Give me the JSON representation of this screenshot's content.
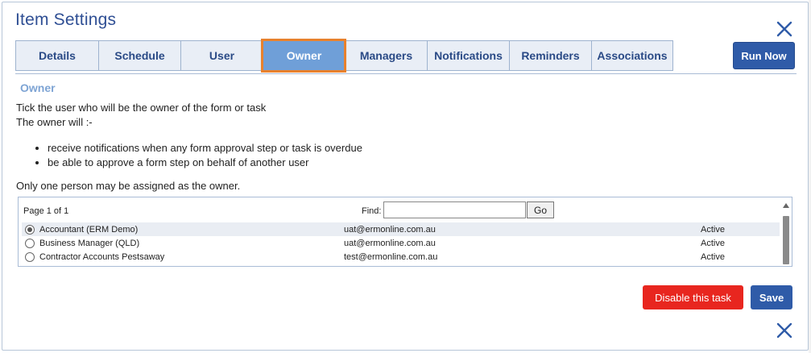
{
  "dialog": {
    "title": "Item Settings",
    "run_now_label": "Run Now"
  },
  "tabs": [
    {
      "label": "Details"
    },
    {
      "label": "Schedule"
    },
    {
      "label": "User"
    },
    {
      "label": "Owner",
      "active": true
    },
    {
      "label": "Managers"
    },
    {
      "label": "Notifications"
    },
    {
      "label": "Reminders"
    },
    {
      "label": "Associations"
    }
  ],
  "owner": {
    "heading": "Owner",
    "intro_line1": "Tick the user who will be the owner of the form or task",
    "intro_line2": "The owner will :-",
    "bullets": [
      "receive notifications when any form approval step or task is overdue",
      "be able to approve a form step on behalf of another user"
    ],
    "note": "Only one person may be assigned as the owner."
  },
  "grid": {
    "page_info": "Page 1 of 1",
    "find_label": "Find:",
    "find_value": "",
    "go_label": "Go",
    "rows": [
      {
        "name": "Accountant (ERM Demo)",
        "email": "uat@ermonline.com.au",
        "status": "Active",
        "selected": true
      },
      {
        "name": "Business Manager (QLD)",
        "email": "uat@ermonline.com.au",
        "status": "Active",
        "selected": false
      },
      {
        "name": "Contractor Accounts Pestsaway",
        "email": "test@ermonline.com.au",
        "status": "Active",
        "selected": false
      }
    ]
  },
  "footer": {
    "disable_label": "Disable this task",
    "save_label": "Save"
  },
  "colors": {
    "brand_blue": "#2f5ba8",
    "active_tab": "#6f9fd8",
    "highlight": "#e8812d",
    "danger": "#e8261f"
  },
  "icons": {
    "close": "close-icon",
    "scroll_up": "chevron-up-icon"
  }
}
